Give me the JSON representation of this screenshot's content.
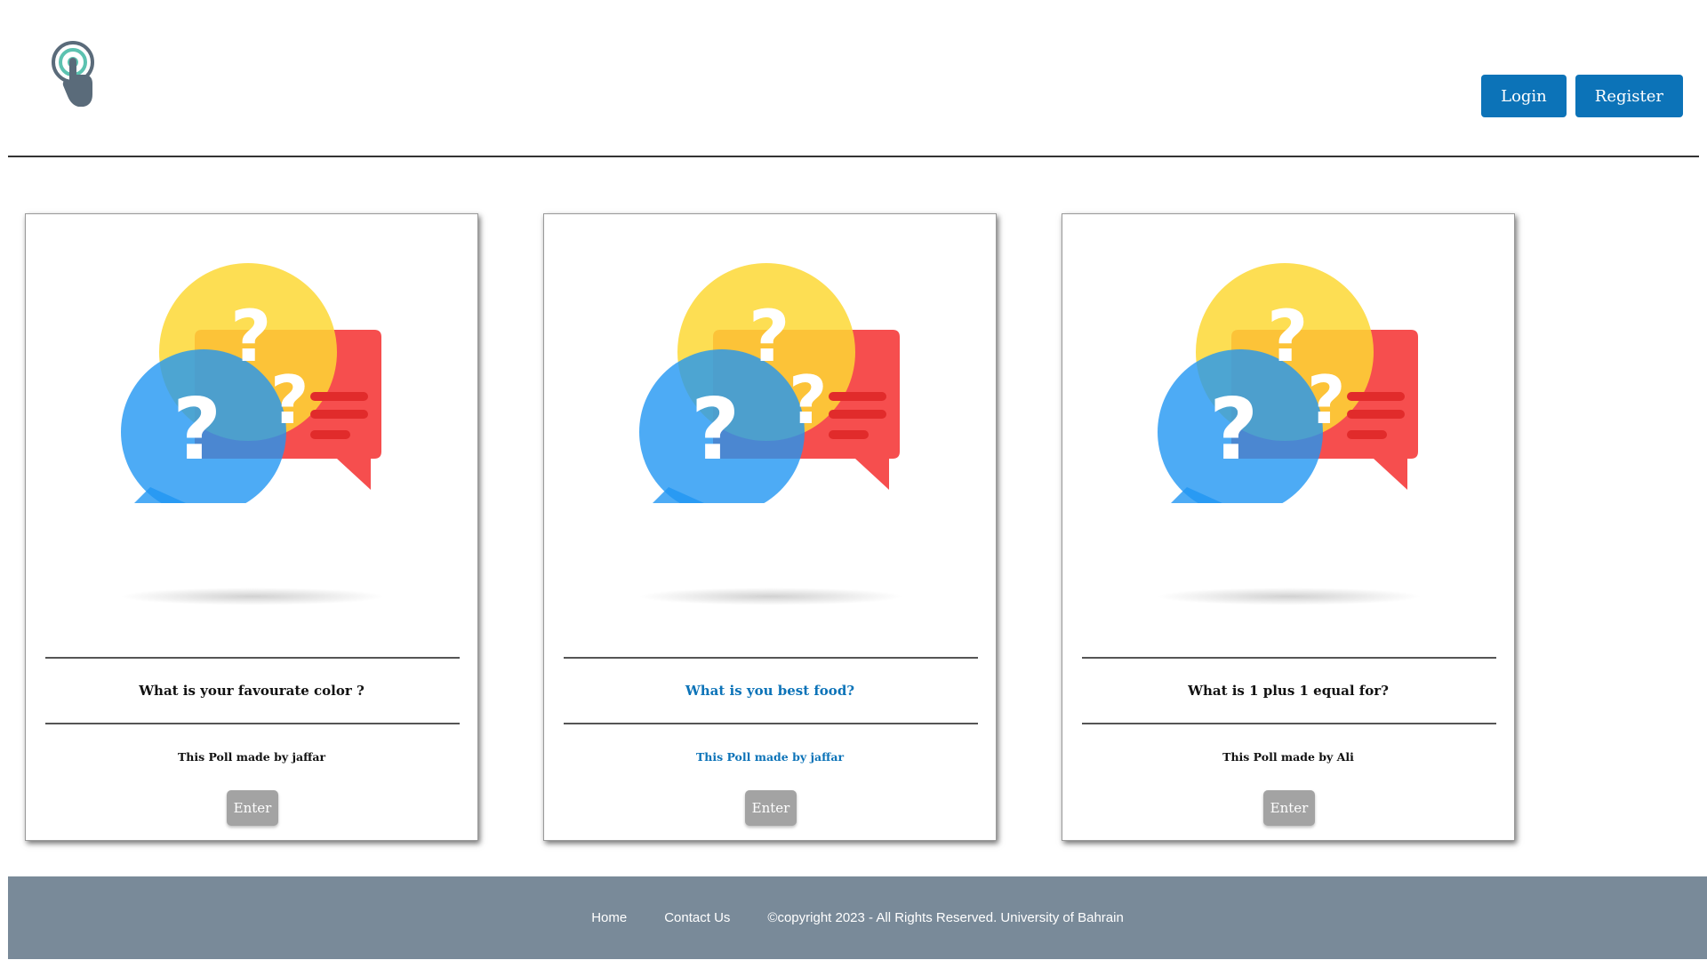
{
  "header": {
    "logo_icon": "touch-pointer-icon",
    "login_label": "Login",
    "register_label": "Register",
    "accent_color": "#0c73b8"
  },
  "polls": [
    {
      "question": "What is your favourate color ?",
      "author": "This Poll made by jaffar",
      "enter_label": "Enter",
      "image_icon": "question-speech-bubbles-icon"
    },
    {
      "question": "What is you best food?",
      "author": "This Poll made by jaffar",
      "enter_label": "Enter",
      "image_icon": "question-speech-bubbles-icon"
    },
    {
      "question": "What is 1 plus 1 equal for?",
      "author": "This Poll made by Ali",
      "enter_label": "Enter",
      "image_icon": "question-speech-bubbles-icon"
    }
  ],
  "footer": {
    "home_label": "Home",
    "contact_label": "Contact Us",
    "copyright": "©copyright 2023 - All Rights Reserved. University of Bahrain",
    "background_color": "#798a99"
  }
}
